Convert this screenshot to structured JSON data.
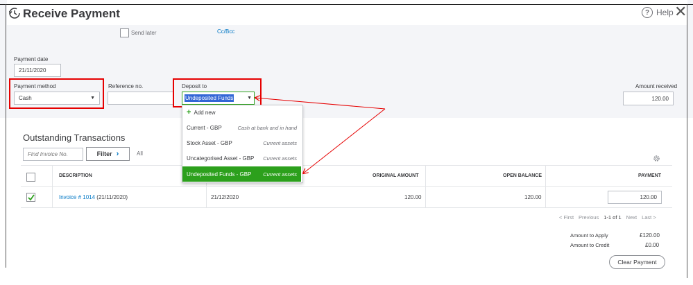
{
  "header": {
    "title": "Receive Payment",
    "help_label": "Help",
    "help_icon": "?",
    "close_glyph": "✕"
  },
  "top": {
    "send_later_label": "Send later",
    "cc_bcc_label": "Cc/Bcc"
  },
  "form": {
    "payment_date_label": "Payment date",
    "payment_date_value": "21/11/2020",
    "payment_method_label": "Payment method",
    "payment_method_value": "Cash",
    "reference_label": "Reference no.",
    "reference_value": "",
    "deposit_to_label": "Deposit to",
    "deposit_to_value": "Undeposited Funds",
    "amount_received_label": "Amount received",
    "amount_received_value": "120.00"
  },
  "dropdown": {
    "add_new": "Add new",
    "items": [
      {
        "name": "Current - GBP",
        "category": "Cash at bank and in hand"
      },
      {
        "name": "Stock Asset - GBP",
        "category": "Current assets"
      },
      {
        "name": "Uncategorised Asset - GBP",
        "category": "Current assets"
      },
      {
        "name": "Undeposited Funds - GBP",
        "category": "Current assets",
        "selected": true
      }
    ]
  },
  "outstanding": {
    "heading": "Outstanding Transactions",
    "find_placeholder": "Find Invoice No.",
    "filter_label": "Filter",
    "filter_chevron": "›",
    "all_label": "All",
    "columns": {
      "description": "DESCRIPTION",
      "original_amount": "ORIGINAL AMOUNT",
      "open_balance": "OPEN BALANCE",
      "payment": "PAYMENT"
    },
    "rows": [
      {
        "checked": true,
        "invoice_link": "Invoice # 1014",
        "invoice_date": "(21/11/2020)",
        "due_date": "21/12/2020",
        "original_amount": "120.00",
        "open_balance": "120.00",
        "payment": "120.00"
      }
    ],
    "pagination": {
      "first": "< First",
      "previous": "Previous",
      "range": "1-1 of 1",
      "next": "Next",
      "last": "Last >"
    }
  },
  "totals": {
    "amount_to_apply_label": "Amount to Apply",
    "amount_to_apply_value": "£120.00",
    "amount_to_credit_label": "Amount to Credit",
    "amount_to_credit_value": "£0.00"
  },
  "clear_payment_label": "Clear Payment",
  "colors": {
    "accent_green": "#2ca01c",
    "link_blue": "#0077c5",
    "highlight_red": "#e60000"
  }
}
